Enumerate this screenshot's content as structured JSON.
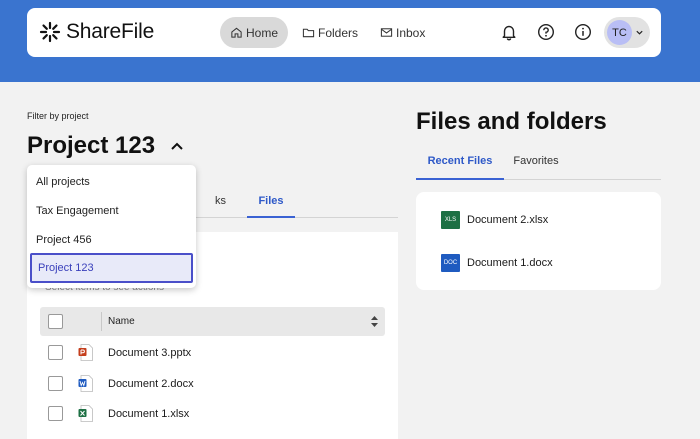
{
  "app": {
    "name": "ShareFile",
    "brand_color": "#3a74cf",
    "accent_color": "#3a62d3"
  },
  "navbar": {
    "items": [
      {
        "label": "Home",
        "icon": "home-icon",
        "active": true
      },
      {
        "label": "Folders",
        "icon": "folder-icon",
        "active": false
      },
      {
        "label": "Inbox",
        "icon": "mail-icon",
        "active": false
      }
    ],
    "right_icons": [
      "bell-icon",
      "help-icon",
      "info-icon"
    ],
    "avatar_initials": "TC"
  },
  "project_filter": {
    "label": "Filter by project",
    "selected": "Project 123",
    "options": [
      "All projects",
      "Tax Engagement",
      "Project 456",
      "Project 123"
    ]
  },
  "left_tabs": {
    "partial_label": "ks",
    "active_label": "Files"
  },
  "files_panel": {
    "hint": "Select items to see actions",
    "column_name": "Name",
    "rows": [
      {
        "name": "Document 3.pptx",
        "type": "pptx"
      },
      {
        "name": "Document 2.docx",
        "type": "docx"
      },
      {
        "name": "Document 1.xlsx",
        "type": "xlsx"
      }
    ]
  },
  "files_and_folders": {
    "title": "Files and folders",
    "tabs": [
      "Recent Files",
      "Favorites"
    ],
    "recent": [
      {
        "name": "Document 2.xlsx",
        "badge": "XLS",
        "color": "#1d7044"
      },
      {
        "name": "Document 1.docx",
        "badge": "DOC",
        "color": "#1f5bc0"
      }
    ]
  }
}
